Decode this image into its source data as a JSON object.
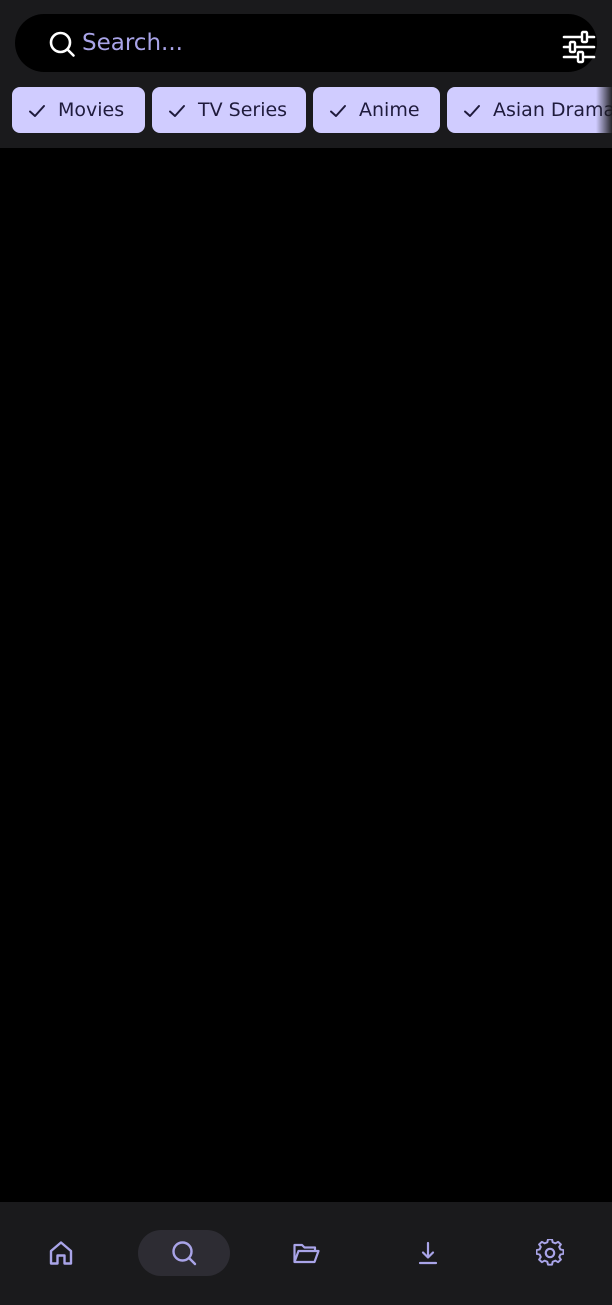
{
  "search": {
    "placeholder": "Search...",
    "value": ""
  },
  "filters": {
    "chips": [
      {
        "label": "Movies",
        "selected": true
      },
      {
        "label": "TV Series",
        "selected": true
      },
      {
        "label": "Anime",
        "selected": true
      },
      {
        "label": "Asian Drama",
        "selected": true
      }
    ]
  },
  "nav": {
    "items": [
      {
        "icon": "home-icon",
        "active": false
      },
      {
        "icon": "search-icon",
        "active": true
      },
      {
        "icon": "folder-icon",
        "active": false
      },
      {
        "icon": "download-icon",
        "active": false
      },
      {
        "icon": "settings-icon",
        "active": false
      }
    ]
  },
  "colors": {
    "background": "#000000",
    "surface": "#1a1a1c",
    "accent": "#a9a4e8",
    "chip_bg": "#d0ccff",
    "chip_text": "#1f1b3c",
    "nav_active_bg": "#2d2c33"
  }
}
